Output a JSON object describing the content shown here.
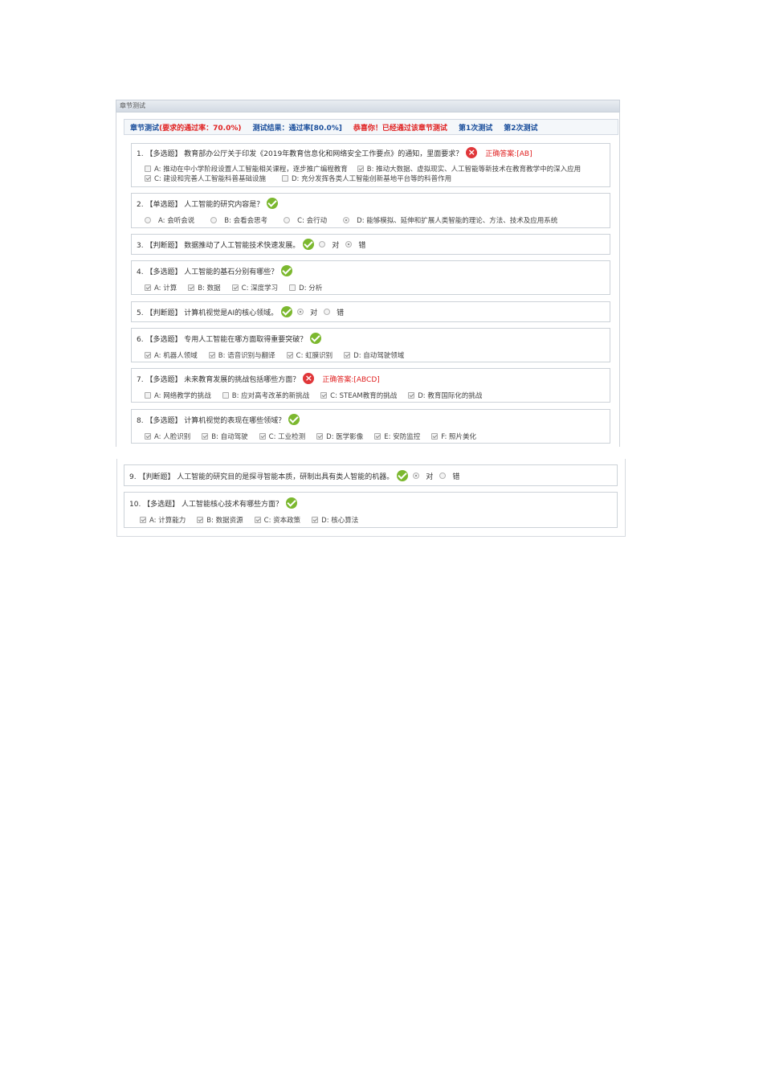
{
  "panel": {
    "title": "章节测试"
  },
  "header": {
    "chapter_test": "章节测试",
    "pass_rate_req": "(要求的通过率：70.0%)",
    "result": "测试结果：通过率[80.0%]",
    "congrats": "恭喜你！已经通过该章节测试",
    "attempt1": "第1次测试",
    "attempt2": "第2次测试"
  },
  "questions": [
    {
      "text": "1. 【多选题】 教育部办公厅关于印发《2019年教育信息化和网络安全工作要点》的通知，里面要求？",
      "answer": "正确答案:[AB]",
      "row1": [
        "A: 推动在中小学阶段设置人工智能相关课程，逐步推广编程教育",
        "B: 推动大数据、虚拟现实、人工智能等新技术在教育教学中的深入应用"
      ],
      "row2": [
        "C: 建设和完善人工智能科普基础设施",
        "D: 充分发挥各类人工智能创新基地平台等的科普作用"
      ]
    },
    {
      "text": "2. 【单选题】 人工智能的研究内容是？",
      "options": [
        "A: 会听会说",
        "B: 会看会思考",
        "C: 会行动",
        "D: 能够模拟、延伸和扩展人类智能的理论、方法、技术及应用系统"
      ]
    },
    {
      "text": "3. 【判断题】 数据推动了人工智能技术快速发展。",
      "options": [
        "对",
        "错"
      ]
    },
    {
      "text": "4. 【多选题】 人工智能的基石分别有哪些？",
      "options": [
        "A: 计算",
        "B: 数据",
        "C: 深度学习",
        "D: 分析"
      ]
    },
    {
      "text": "5. 【判断题】 计算机视觉是AI的核心领域。",
      "options": [
        "对",
        "错"
      ]
    },
    {
      "text": "6. 【多选题】 专用人工智能在哪方面取得重要突破？",
      "options": [
        "A: 机器人领域",
        "B: 语音识别与翻译",
        "C: 虹膜识别",
        "D: 自动驾驶领域"
      ]
    },
    {
      "text": "7. 【多选题】 未来教育发展的挑战包括哪些方面？",
      "answer": "正确答案:[ABCD]",
      "options": [
        "A: 网络教学的挑战",
        "B: 应对高考改革的新挑战",
        "C: STEAM教育的挑战",
        "D: 教育国际化的挑战"
      ]
    },
    {
      "text": "8. 【多选题】 计算机视觉的表现在哪些领域？",
      "options": [
        "A: 人脸识别",
        "B: 自动驾驶",
        "C: 工业检测",
        "D: 医学影像",
        "E: 安防监控",
        "F: 照片美化"
      ]
    },
    {
      "text": "9. 【判断题】 人工智能的研究目的是探寻智能本质，研制出具有类人智能的机器。",
      "options": [
        "对",
        "错"
      ]
    },
    {
      "text": "10. 【多选题】 人工智能核心技术有哪些方面？",
      "options": [
        "A: 计算能力",
        "B: 数据资源",
        "C: 资本政策",
        "D: 核心算法"
      ]
    }
  ]
}
